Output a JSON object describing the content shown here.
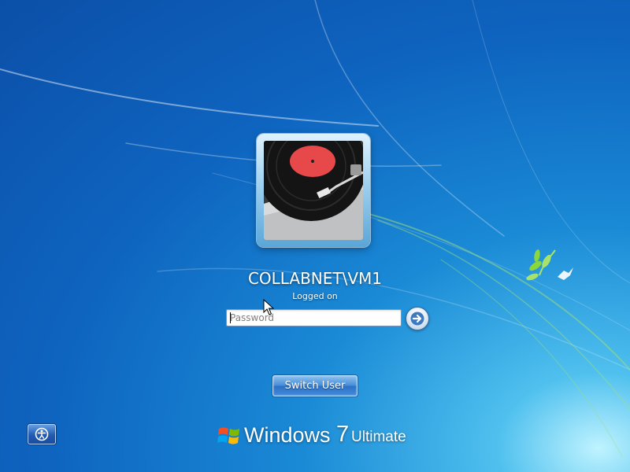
{
  "user": {
    "name": "COLLABNET\\VM1",
    "status": "Logged on",
    "avatar_icon": "record-player-icon"
  },
  "password": {
    "placeholder": "Password",
    "value": ""
  },
  "submit": {
    "icon": "arrow-right-icon"
  },
  "switch_user": {
    "label": "Switch User"
  },
  "ease_of_access": {
    "icon": "ease-of-access-icon"
  },
  "branding": {
    "name": "Windows",
    "version": "7",
    "edition": "Ultimate",
    "logo_icon": "windows-flag-icon"
  },
  "colors": {
    "background_dark": "#0b4fa8",
    "background_light": "#4fc0ee",
    "accent_green": "#8bd63a"
  }
}
